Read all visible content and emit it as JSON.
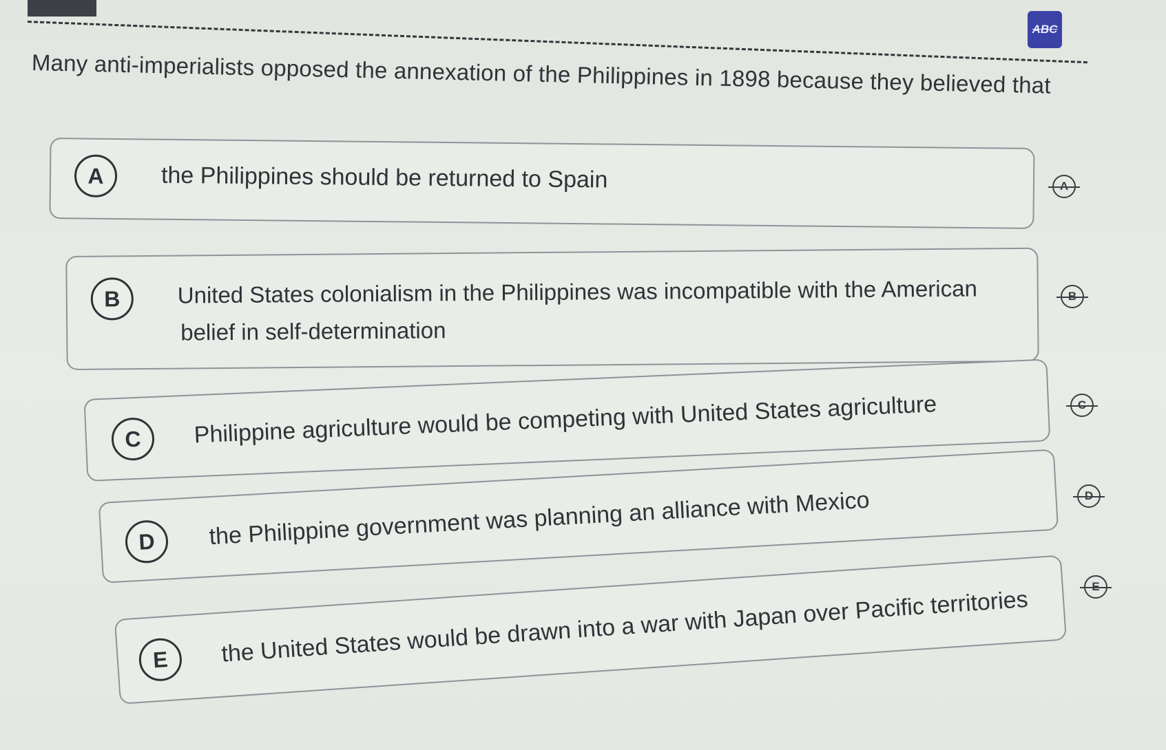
{
  "toolbar": {
    "abc_label": "ABC"
  },
  "question": {
    "text": "Many anti-imperialists opposed the annexation of the Philippines in 1898 because they believed that"
  },
  "options": [
    {
      "letter": "A",
      "text_line1": "the Philippines should be returned to Spain",
      "text_line2": ""
    },
    {
      "letter": "B",
      "text_line1": "United States colonialism in the Philippines was incompatible with the American",
      "text_line2": "belief in self-determination"
    },
    {
      "letter": "C",
      "text_line1": "Philippine agriculture would be competing with United States agriculture",
      "text_line2": ""
    },
    {
      "letter": "D",
      "text_line1": "the Philippine government was planning an alliance with Mexico",
      "text_line2": ""
    },
    {
      "letter": "E",
      "text_line1": "the United States would be drawn into a war with Japan over Pacific territories",
      "text_line2": ""
    }
  ]
}
